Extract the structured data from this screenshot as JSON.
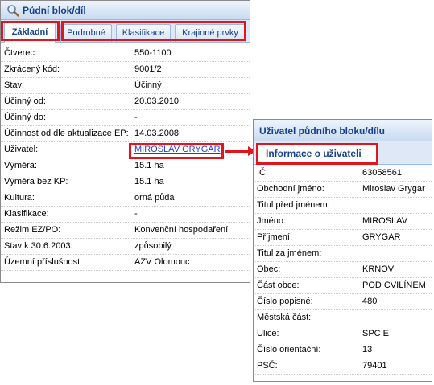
{
  "left_panel": {
    "title": "Půdní blok/díl",
    "tabs": [
      {
        "label": "Základní",
        "active": true
      },
      {
        "label": "Podrobné",
        "active": false
      },
      {
        "label": "Klasifikace",
        "active": false
      },
      {
        "label": "Krajinné prvky",
        "active": false
      }
    ],
    "rows": [
      {
        "label": "Čtverec:",
        "value": "550-1100"
      },
      {
        "label": "Zkrácený kód:",
        "value": "9001/2"
      },
      {
        "label": "Stav:",
        "value": "Účinný"
      },
      {
        "label": "Účinný od:",
        "value": "20.03.2010"
      },
      {
        "label": "Účinný do:",
        "value": "-"
      },
      {
        "label": "Účinnost od dle aktualizace EP:",
        "value": "14.03.2008"
      },
      {
        "label": "Uživatel:",
        "value": "MIROSLAV GRYGAR",
        "link": true
      },
      {
        "label": "Výměra:",
        "value": "15.1 ha"
      },
      {
        "label": "Výměra bez KP:",
        "value": "15.1 ha"
      },
      {
        "label": "Kultura:",
        "value": "orná půda"
      },
      {
        "label": "Klasifikace:",
        "value": "-"
      },
      {
        "label": "Režim EZ/PO:",
        "value": "Konvenční hospodaření"
      },
      {
        "label": "Stav k 30.6.2003:",
        "value": "způsobilý"
      },
      {
        "label": "Územní příslušnost:",
        "value": "AZV Olomouc"
      }
    ]
  },
  "right_panel": {
    "title": "Uživatel půdního bloku/dílu",
    "tab": "Informace o uživateli",
    "rows": [
      {
        "label": "IČ:",
        "value": "63058561"
      },
      {
        "label": "Obchodní jméno:",
        "value": "Miroslav Grygar"
      },
      {
        "label": "Titul před jménem:",
        "value": ""
      },
      {
        "label": "Jméno:",
        "value": "MIROSLAV"
      },
      {
        "label": "Příjmení:",
        "value": "GRYGAR"
      },
      {
        "label": "Titul za jménem:",
        "value": ""
      },
      {
        "label": "Obec:",
        "value": "KRNOV"
      },
      {
        "label": "Část obce:",
        "value": "POD CVILÍNEM"
      },
      {
        "label": "Číslo popisné:",
        "value": "480"
      },
      {
        "label": "Městská část:",
        "value": ""
      },
      {
        "label": "Ulice:",
        "value": "SPC E"
      },
      {
        "label": "Číslo orientační:",
        "value": "13"
      },
      {
        "label": "PSČ:",
        "value": "79401"
      }
    ]
  },
  "colors": {
    "highlight": "#e2141c",
    "title_text": "#15428b",
    "link": "#1f3ec8"
  },
  "icons": {
    "title_icon": "magnifier-icon",
    "arrow": "arrow-right-icon"
  }
}
